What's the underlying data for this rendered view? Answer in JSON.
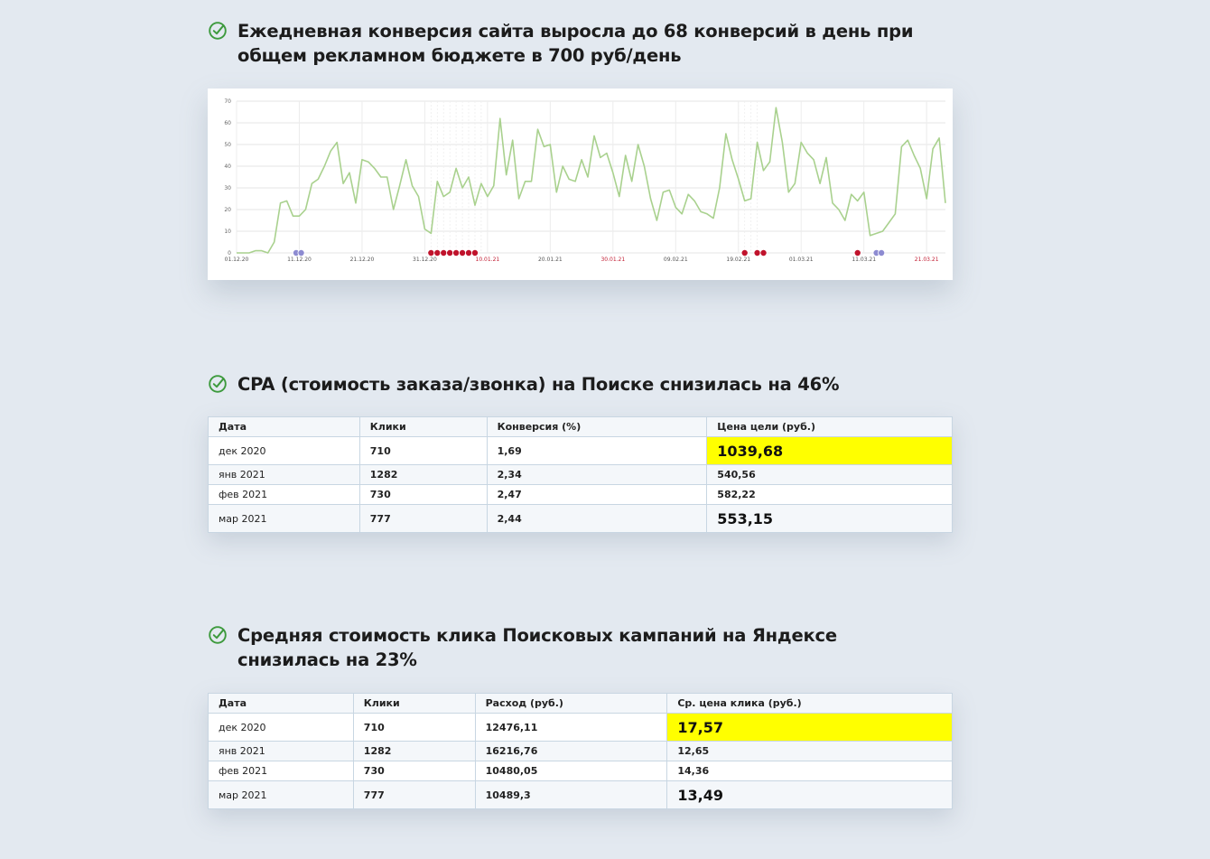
{
  "colors": {
    "accent_check": "#3d9a3d",
    "highlight": "#ffff00",
    "line": "#a9d18e",
    "marker_red": "#c0132c",
    "marker_purple": "#8d8bd1"
  },
  "section1": {
    "title": "Ежедневная конверсия сайта выросла до 68 конверсий в день при общем рекламном бюджете в 700 руб/день",
    "icon": "check-circle-icon"
  },
  "section2": {
    "title": "CPA (стоимость заказа/звонка) на Поиске снизилась на 46%",
    "icon": "check-circle-icon"
  },
  "section3": {
    "title": "Средняя стоимость клика Поисковых кампаний на Яндексе снизилась на 23%",
    "icon": "check-circle-icon"
  },
  "chart_data": {
    "type": "line",
    "ylim": [
      0,
      70
    ],
    "yticks": [
      "0",
      "10",
      "20",
      "30",
      "40",
      "50",
      "60",
      "70"
    ],
    "x_ticks": [
      {
        "label": "01.12.20",
        "day": 0,
        "weekend": false
      },
      {
        "label": "11.12.20",
        "day": 10,
        "weekend": false
      },
      {
        "label": "21.12.20",
        "day": 20,
        "weekend": false
      },
      {
        "label": "31.12.20",
        "day": 30,
        "weekend": false
      },
      {
        "label": "10.01.21",
        "day": 40,
        "weekend": true
      },
      {
        "label": "20.01.21",
        "day": 50,
        "weekend": false
      },
      {
        "label": "30.01.21",
        "day": 60,
        "weekend": true
      },
      {
        "label": "09.02.21",
        "day": 70,
        "weekend": false
      },
      {
        "label": "19.02.21",
        "day": 80,
        "weekend": false
      },
      {
        "label": "01.03.21",
        "day": 90,
        "weekend": false
      },
      {
        "label": "11.03.21",
        "day": 100,
        "weekend": false
      },
      {
        "label": "21.03.21",
        "day": 110,
        "weekend": true
      }
    ],
    "days": 114,
    "values": [
      0,
      0,
      0,
      1,
      1,
      0,
      5,
      23,
      24,
      17,
      17,
      20,
      32,
      34,
      40,
      47,
      51,
      32,
      37,
      23,
      43,
      42,
      39,
      35,
      35,
      20,
      31,
      43,
      31,
      26,
      11,
      9,
      33,
      26,
      28,
      39,
      30,
      35,
      22,
      32,
      26,
      31,
      62,
      36,
      52,
      25,
      33,
      33,
      57,
      49,
      50,
      28,
      40,
      34,
      33,
      43,
      35,
      54,
      44,
      46,
      37,
      26,
      45,
      33,
      50,
      40,
      25,
      15,
      28,
      29,
      21,
      18,
      27,
      24,
      19,
      18,
      16,
      30,
      55,
      43,
      34,
      24,
      25,
      51,
      38,
      42,
      67,
      51,
      28,
      32,
      51,
      46,
      43,
      32,
      44,
      23,
      20,
      15,
      27,
      24,
      28,
      8,
      9,
      10,
      14,
      18,
      49,
      52,
      45,
      39,
      25,
      48,
      53,
      23
    ],
    "markers": [
      {
        "day": 9.5,
        "type": "purple"
      },
      {
        "day": 10.3,
        "type": "purple"
      },
      {
        "day": 31,
        "type": "red"
      },
      {
        "day": 32,
        "type": "red"
      },
      {
        "day": 33,
        "type": "red"
      },
      {
        "day": 34,
        "type": "red"
      },
      {
        "day": 35,
        "type": "red"
      },
      {
        "day": 36,
        "type": "red"
      },
      {
        "day": 37,
        "type": "red"
      },
      {
        "day": 38,
        "type": "red"
      },
      {
        "day": 81,
        "type": "red"
      },
      {
        "day": 83,
        "type": "red"
      },
      {
        "day": 84,
        "type": "red"
      },
      {
        "day": 99,
        "type": "red"
      },
      {
        "day": 102,
        "type": "purple"
      },
      {
        "day": 102.8,
        "type": "purple"
      }
    ]
  },
  "table1": {
    "headers": [
      "Дата",
      "Клики",
      "Конверсия (%)",
      "Цена цели (руб.)"
    ],
    "rows": [
      [
        "дек 2020",
        "710",
        "1,69",
        "1039,68"
      ],
      [
        "янв 2021",
        "1282",
        "2,34",
        "540,56"
      ],
      [
        "фев 2021",
        "730",
        "2,47",
        "582,22"
      ],
      [
        "мар 2021",
        "777",
        "2,44",
        "553,15"
      ]
    ]
  },
  "table2": {
    "headers": [
      "Дата",
      "Клики",
      "Расход (руб.)",
      "Ср. цена клика (руб.)"
    ],
    "rows": [
      [
        "дек 2020",
        "710",
        "12476,11",
        "17,57"
      ],
      [
        "янв 2021",
        "1282",
        "16216,76",
        "12,65"
      ],
      [
        "фев 2021",
        "730",
        "10480,05",
        "14,36"
      ],
      [
        "мар 2021",
        "777",
        "10489,3",
        "13,49"
      ]
    ]
  }
}
